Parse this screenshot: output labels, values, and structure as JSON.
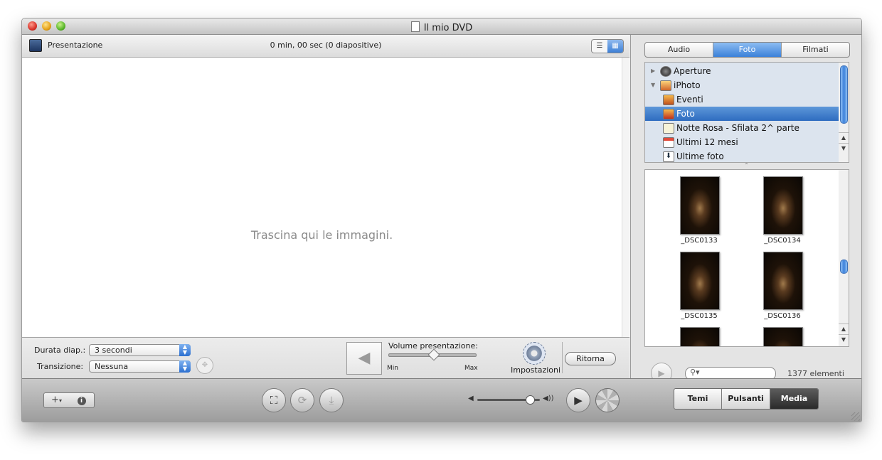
{
  "window": {
    "title": "Il mio DVD"
  },
  "header": {
    "label": "Presentazione",
    "info": "0 min, 00 sec  (0 diapositive)"
  },
  "drop_area": {
    "placeholder": "Trascina qui le immagini."
  },
  "controls": {
    "duration_label": "Durata diap.:",
    "duration_value": "3 secondi",
    "transition_label": "Transizione:",
    "transition_value": "Nessuna",
    "volume_label": "Volume presentazione:",
    "volume_min": "Min",
    "volume_max": "Max",
    "volume_level": 0.5,
    "settings_label": "Impostazioni",
    "back_button": "Ritorna"
  },
  "media_tabs": [
    {
      "label": "Audio",
      "active": false
    },
    {
      "label": "Foto",
      "active": true
    },
    {
      "label": "Filmati",
      "active": false
    }
  ],
  "sources": [
    {
      "label": "Aperture",
      "icon": "aperture-icon",
      "expander": "collapsed"
    },
    {
      "label": "iPhoto",
      "icon": "iphoto-icon",
      "expander": "expanded"
    },
    {
      "label": "Eventi",
      "icon": "events-icon"
    },
    {
      "label": "Foto",
      "icon": "photos-icon",
      "selected": true
    },
    {
      "label": "Notte Rosa - Sfilata 2^ parte",
      "icon": "album-icon"
    },
    {
      "label": "Ultimi 12 mesi",
      "icon": "calendar-icon"
    },
    {
      "label": "Ultime foto",
      "icon": "import-icon"
    }
  ],
  "photos": [
    {
      "caption": "_DSC0133"
    },
    {
      "caption": "_DSC0134"
    },
    {
      "caption": "_DSC0135"
    },
    {
      "caption": "_DSC0136"
    },
    {
      "caption": ""
    },
    {
      "caption": ""
    }
  ],
  "search": {
    "value": "",
    "icon": "search-icon"
  },
  "element_count": "1377 elementi",
  "bottom_toolbar": {
    "add_icon": "+",
    "info_icon": "i",
    "modes": [
      {
        "label": "Temi",
        "active": false
      },
      {
        "label": "Pulsanti",
        "active": false
      },
      {
        "label": "Media",
        "active": true
      }
    ],
    "playback_volume": 0.82
  }
}
